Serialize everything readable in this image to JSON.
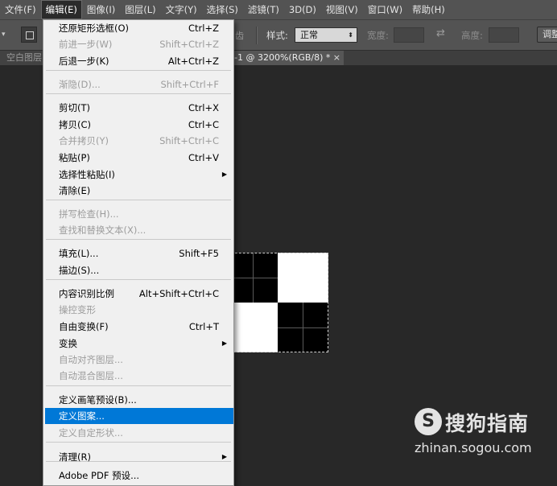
{
  "menubar": {
    "items": [
      "文件(F)",
      "编辑(E)",
      "图像(I)",
      "图层(L)",
      "文字(Y)",
      "选择(S)",
      "滤镜(T)",
      "3D(D)",
      "视图(V)",
      "窗口(W)",
      "帮助(H)"
    ],
    "active_index": 1
  },
  "options_bar": {
    "truncated_text": "齿",
    "style_label": "样式:",
    "style_value": "正常",
    "width_label": "宽度:",
    "height_label": "高度:",
    "refine_label": "调整"
  },
  "tabs": {
    "left_partial": "空白图层",
    "doc_title": "-1 @ 3200%(RGB/8) *",
    "close_glyph": "×"
  },
  "edit_menu": {
    "items": [
      {
        "label": "还原矩形选框(O)",
        "shortcut": "Ctrl+Z",
        "disabled": false
      },
      {
        "label": "前进一步(W)",
        "shortcut": "Shift+Ctrl+Z",
        "disabled": true
      },
      {
        "label": "后退一步(K)",
        "shortcut": "Alt+Ctrl+Z",
        "disabled": false
      },
      {
        "label": "渐隐(D)...",
        "shortcut": "Shift+Ctrl+F",
        "disabled": true
      },
      {
        "label": "剪切(T)",
        "shortcut": "Ctrl+X",
        "disabled": false
      },
      {
        "label": "拷贝(C)",
        "shortcut": "Ctrl+C",
        "disabled": false
      },
      {
        "label": "合并拷贝(Y)",
        "shortcut": "Shift+Ctrl+C",
        "disabled": true
      },
      {
        "label": "粘贴(P)",
        "shortcut": "Ctrl+V",
        "disabled": false
      },
      {
        "label": "选择性粘贴(I)",
        "shortcut": "",
        "disabled": false,
        "submenu": true
      },
      {
        "label": "清除(E)",
        "shortcut": "",
        "disabled": false
      },
      {
        "label": "拼写检查(H)...",
        "shortcut": "",
        "disabled": true
      },
      {
        "label": "查找和替换文本(X)...",
        "shortcut": "",
        "disabled": true
      },
      {
        "label": "填充(L)...",
        "shortcut": "Shift+F5",
        "disabled": false
      },
      {
        "label": "描边(S)...",
        "shortcut": "",
        "disabled": false
      },
      {
        "label": "内容识别比例",
        "shortcut": "Alt+Shift+Ctrl+C",
        "disabled": false
      },
      {
        "label": "操控变形",
        "shortcut": "",
        "disabled": true
      },
      {
        "label": "自由变换(F)",
        "shortcut": "Ctrl+T",
        "disabled": false
      },
      {
        "label": "变换",
        "shortcut": "",
        "disabled": false,
        "submenu": true
      },
      {
        "label": "自动对齐图层...",
        "shortcut": "",
        "disabled": true
      },
      {
        "label": "自动混合图层...",
        "shortcut": "",
        "disabled": true
      },
      {
        "label": "定义画笔预设(B)...",
        "shortcut": "",
        "disabled": false
      },
      {
        "label": "定义图案...",
        "shortcut": "",
        "disabled": false,
        "highlighted": true
      },
      {
        "label": "定义自定形状...",
        "shortcut": "",
        "disabled": true
      },
      {
        "label": "清理(R)",
        "shortcut": "",
        "disabled": false,
        "submenu": true
      },
      {
        "label": "Adobe PDF 预设...",
        "shortcut": "",
        "disabled": false
      }
    ]
  },
  "watermark": {
    "icon_glyph": "S",
    "brand": "搜狗指南",
    "url": "zhinan.sogou.com"
  },
  "colors": {
    "highlight": "#0078d7",
    "menu_bg": "#f0f0f0",
    "workspace": "#282828",
    "toolbar": "#535353"
  }
}
